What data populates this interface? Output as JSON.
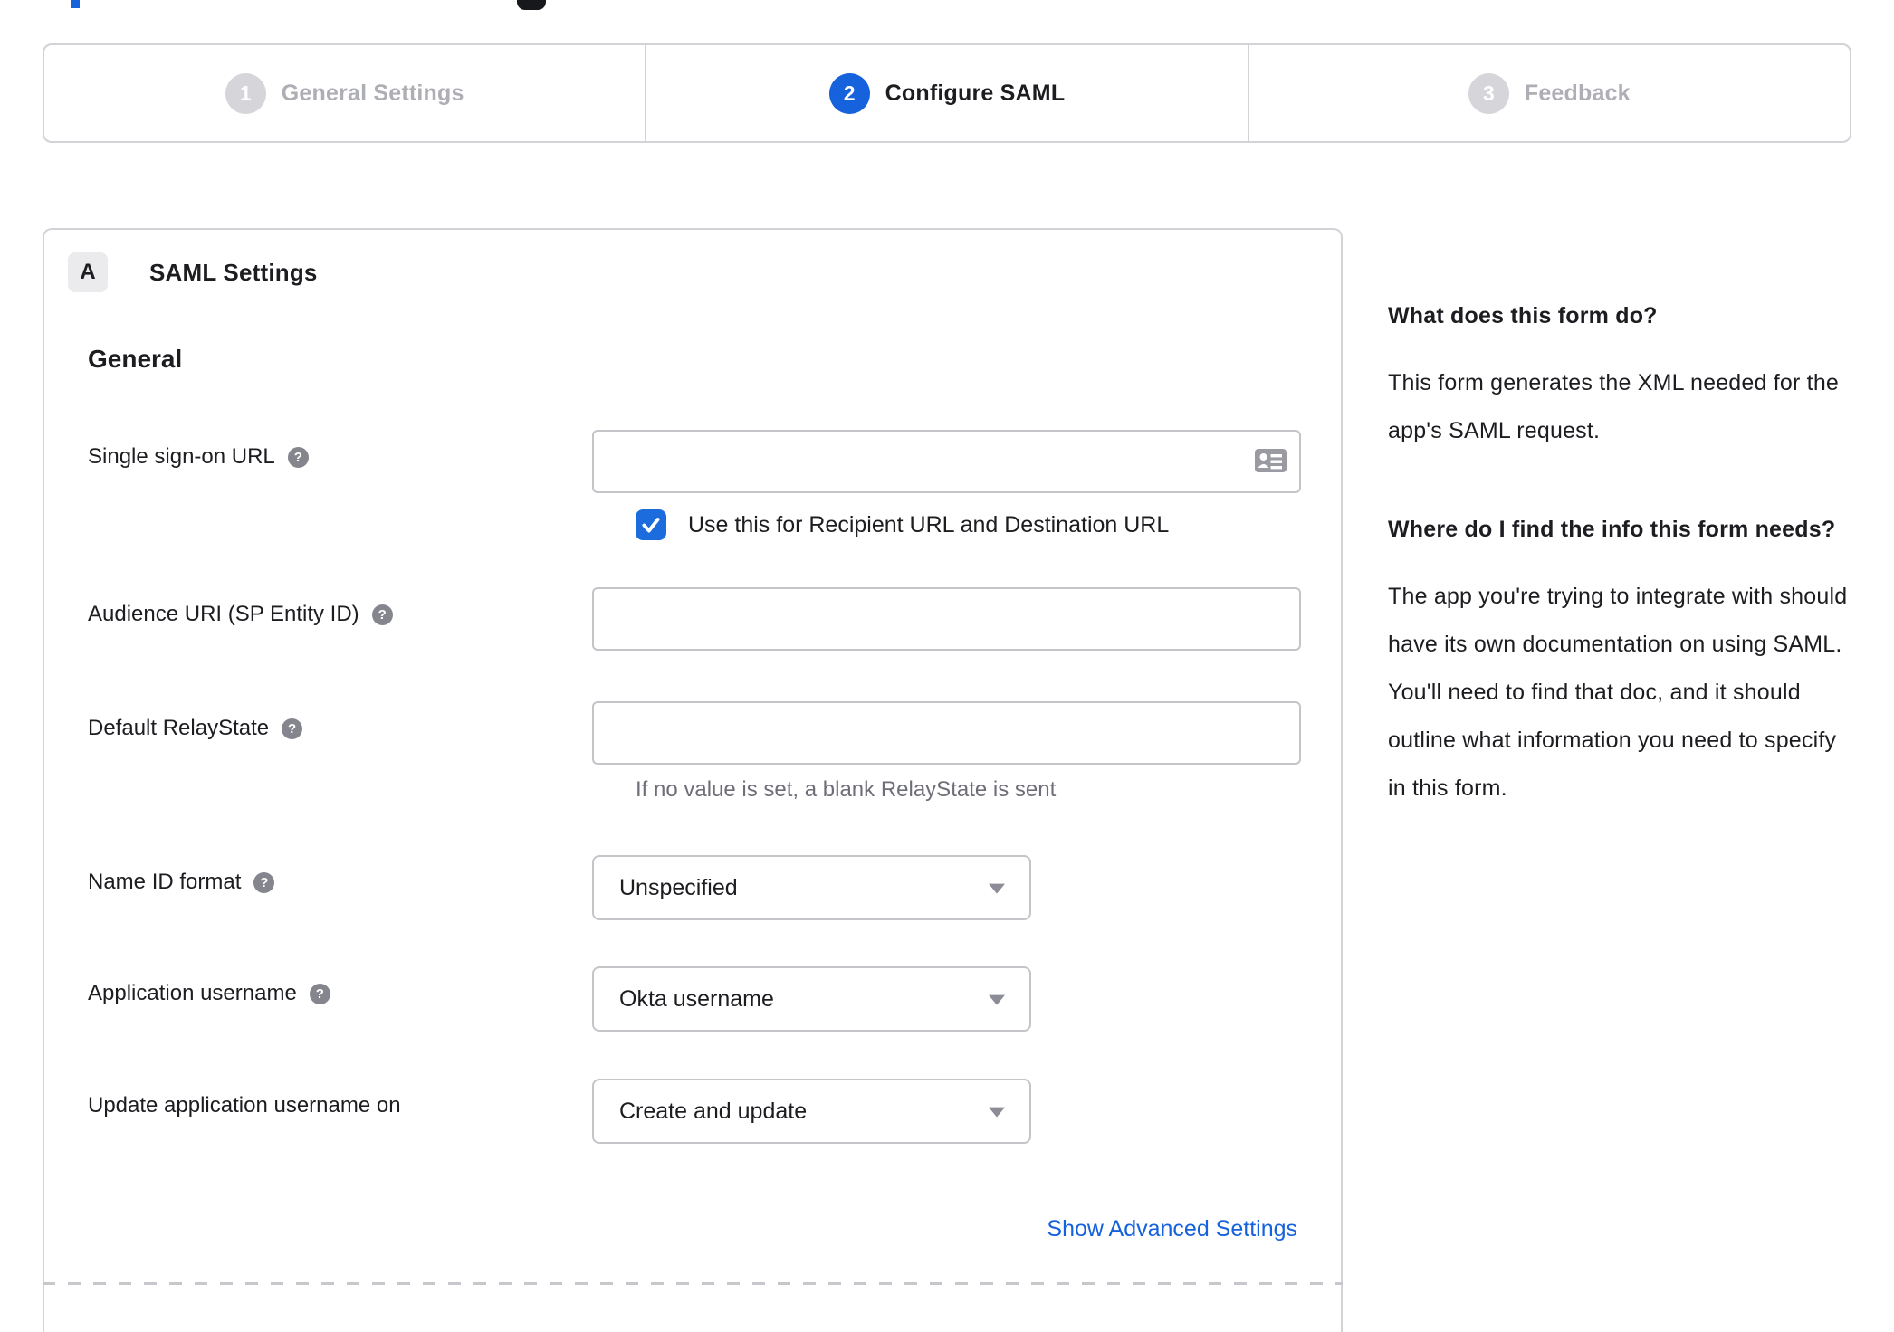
{
  "colors": {
    "accent_blue": "#1662dd",
    "text_dark": "#1d1d21",
    "helper_gray": "#6e6e78",
    "inactive_gray": "#aeaeb5",
    "border_gray": "#d2d2d7"
  },
  "stepper": {
    "steps": [
      {
        "number": "1",
        "label": "General Settings",
        "active": false
      },
      {
        "number": "2",
        "label": "Configure SAML",
        "active": true
      },
      {
        "number": "3",
        "label": "Feedback",
        "active": false
      }
    ]
  },
  "panel": {
    "badge": "A",
    "title": "SAML Settings",
    "section_heading": "General",
    "fields": {
      "sso_url": {
        "label": "Single sign-on URL",
        "value": ""
      },
      "sso_checkbox": {
        "label": "Use this for Recipient URL and Destination URL",
        "checked": true
      },
      "audience_uri": {
        "label": "Audience URI (SP Entity ID)",
        "value": ""
      },
      "relay_state": {
        "label": "Default RelayState",
        "value": "",
        "helper": "If no value is set, a blank RelayState is sent"
      },
      "name_id_format": {
        "label": "Name ID format",
        "value": "Unspecified"
      },
      "app_username": {
        "label": "Application username",
        "value": "Okta username"
      },
      "update_username": {
        "label": "Update application username on",
        "value": "Create and update"
      }
    },
    "advanced_link": "Show Advanced Settings"
  },
  "help": {
    "sections": [
      {
        "heading": "What does this form do?",
        "body": "This form generates the XML needed for the app's SAML request."
      },
      {
        "heading": "Where do I find the info this form needs?",
        "body": "The app you're trying to integrate with should have its own documentation on using SAML. You'll need to find that doc, and it should outline what information you need to specify in this form."
      }
    ]
  }
}
